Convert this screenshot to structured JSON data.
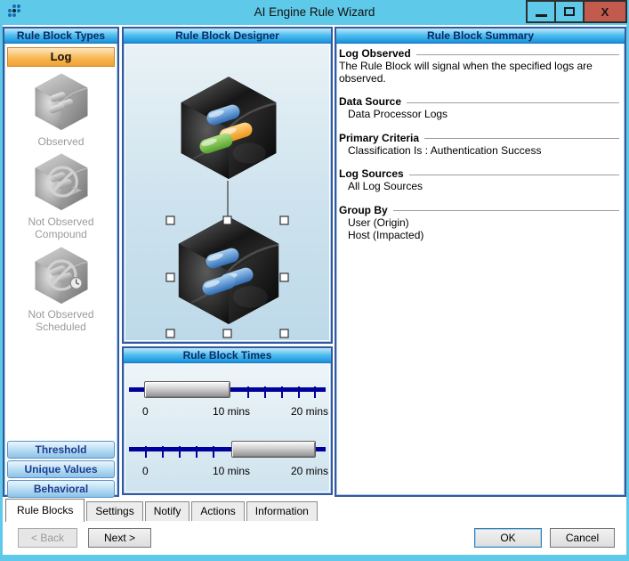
{
  "window": {
    "title": "AI Engine Rule Wizard",
    "controls": {
      "close": "X"
    }
  },
  "left_panel": {
    "header": "Rule Block Types",
    "selected_type": "Log",
    "type_labels": [
      "Observed",
      "Not Observed Compound",
      "Not Observed Scheduled"
    ],
    "buttons": [
      "Threshold",
      "Unique Values",
      "Behavioral"
    ]
  },
  "designer": {
    "header": "Rule Block Designer"
  },
  "times": {
    "header": "Rule Block Times",
    "sliders": [
      {
        "labels": [
          "0",
          "10 mins",
          "20 mins"
        ],
        "selected_range": "0 to 10 mins"
      },
      {
        "labels": [
          "0",
          "10 mins",
          "20 mins"
        ],
        "selected_range": "10 to 20 mins"
      }
    ]
  },
  "summary": {
    "header": "Rule Block Summary",
    "sections": [
      {
        "title": "Log Observed",
        "lines": [
          "The Rule Block will signal when the specified logs are observed."
        ]
      },
      {
        "title": "Data Source",
        "lines": [
          "Data Processor Logs"
        ]
      },
      {
        "title": "Primary Criteria",
        "lines": [
          "Classification Is : Authentication Success"
        ]
      },
      {
        "title": "Log Sources",
        "lines": [
          "All Log Sources"
        ]
      },
      {
        "title": "Group By",
        "lines": [
          "User (Origin)",
          "Host (Impacted)"
        ]
      }
    ]
  },
  "tabs": [
    "Rule Blocks",
    "Settings",
    "Notify",
    "Actions",
    "Information"
  ],
  "footer": {
    "back": "< Back",
    "next": "Next >",
    "ok": "OK",
    "cancel": "Cancel"
  },
  "colors": {
    "titlebar": "#5fc9e9",
    "close_button": "#c25a4e",
    "header_gradient_bottom": "#1493dc",
    "log_button_orange": "#f2a233",
    "slider_track_navy": "#00009b",
    "panel_border": "#35599e",
    "capsule_blue": "#2f6db8",
    "capsule_orange": "#ef9414",
    "capsule_green": "#54a32c"
  }
}
